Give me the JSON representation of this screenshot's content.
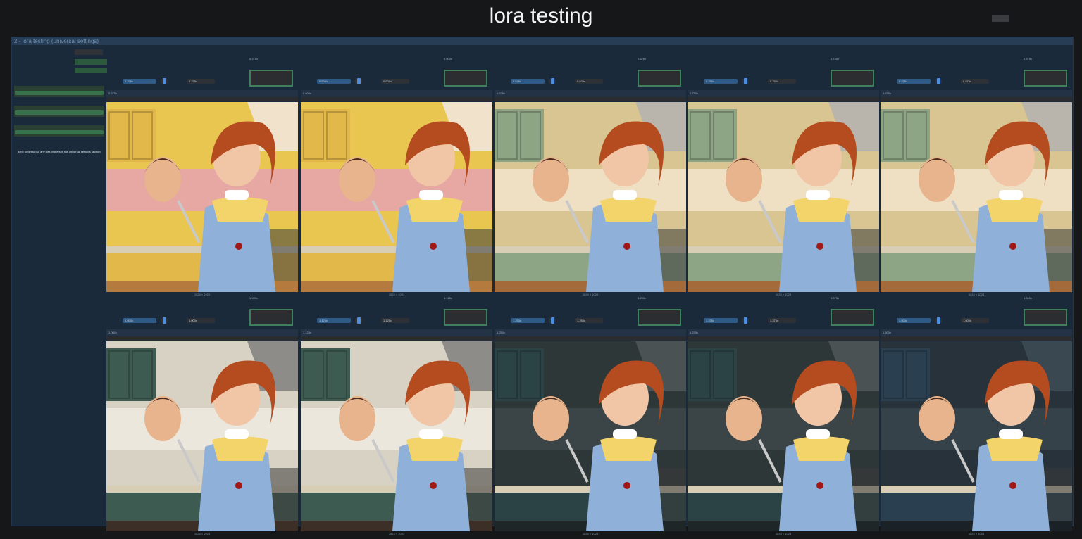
{
  "app": {
    "title": "lora testing"
  },
  "group": {
    "header": "2 - lora testing (universal settings)"
  },
  "sidebar": {
    "note": "don't forget to put any lora triggers in the universal settings section!"
  },
  "colors": {
    "background": "#161718",
    "panel": "#1b2a3a",
    "panel_header": "#263d55",
    "widget_green": "#37724d",
    "slider_blue": "#2d5a86",
    "preview_border": "#3f7f5c"
  },
  "grid": {
    "rows": [
      [
        {
          "lora_weight": "0.375x",
          "strength_model": "0.375x",
          "strength_clip": "0.375x",
          "dims": "1024 × 1024",
          "style": "cartoon"
        },
        {
          "lora_weight": "0.500x",
          "strength_model": "0.500x",
          "strength_clip": "0.500x",
          "dims": "1024 × 1024",
          "style": "cartoon"
        },
        {
          "lora_weight": "0.625x",
          "strength_model": "0.625x",
          "strength_clip": "0.625x",
          "dims": "1024 × 1024",
          "style": "illustration"
        },
        {
          "lora_weight": "0.750x",
          "strength_model": "0.750x",
          "strength_clip": "0.750x",
          "dims": "1024 × 1024",
          "style": "illustration"
        },
        {
          "lora_weight": "0.875x",
          "strength_model": "0.875x",
          "strength_clip": "0.875x",
          "dims": "1024 × 1024",
          "style": "illustration"
        }
      ],
      [
        {
          "lora_weight": "1.000x",
          "strength_model": "1.000x",
          "strength_clip": "1.000x",
          "dims": "1024 × 1024",
          "style": "photo"
        },
        {
          "lora_weight": "1.125x",
          "strength_model": "1.125x",
          "strength_clip": "1.125x",
          "dims": "1024 × 1024",
          "style": "photo"
        },
        {
          "lora_weight": "1.250x",
          "strength_model": "1.250x",
          "strength_clip": "1.250x",
          "dims": "1024 × 1024",
          "style": "dark"
        },
        {
          "lora_weight": "1.375x",
          "strength_model": "1.375x",
          "strength_clip": "1.375x",
          "dims": "1024 × 1024",
          "style": "dark"
        },
        {
          "lora_weight": "1.500x",
          "strength_model": "1.500x",
          "strength_clip": "1.500x",
          "dims": "1024 × 1024",
          "style": "darker"
        }
      ]
    ]
  }
}
